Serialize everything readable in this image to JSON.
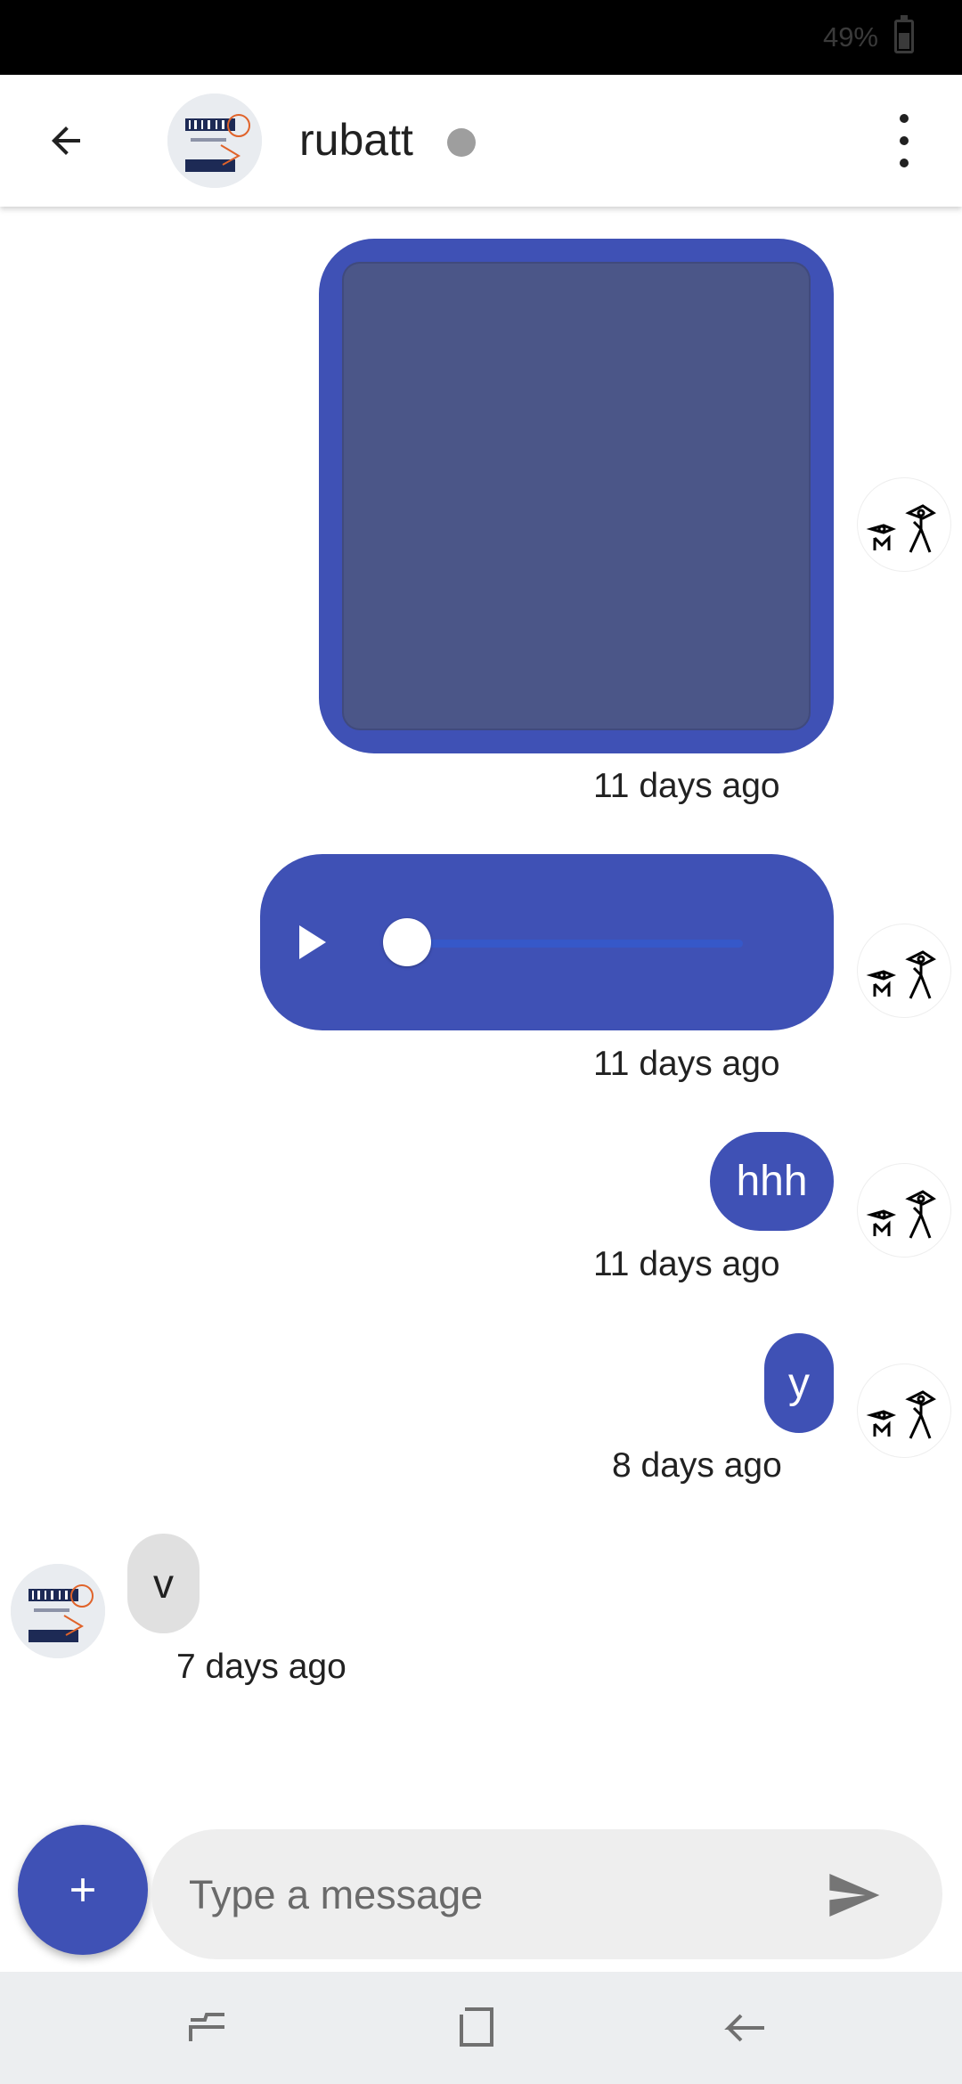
{
  "status_bar": {
    "battery": "49%"
  },
  "header": {
    "back_icon": "arrow-back-icon",
    "contact_name": "rubatt",
    "presence": "offline",
    "presence_color": "#9e9e9e",
    "menu_icon": "more-vert-icon"
  },
  "colors": {
    "accent": "#3f51b5",
    "incoming_bubble": "#e0e0e0",
    "image_placeholder": "#4b5688"
  },
  "messages": [
    {
      "type": "image",
      "direction": "outgoing",
      "timestamp": "11 days ago"
    },
    {
      "type": "audio",
      "direction": "outgoing",
      "progress": 0.0,
      "timestamp": "11 days ago"
    },
    {
      "type": "text",
      "direction": "outgoing",
      "text": "hhh",
      "timestamp": "11 days ago"
    },
    {
      "type": "text",
      "direction": "outgoing",
      "text": "y",
      "timestamp": "8 days ago"
    },
    {
      "type": "text",
      "direction": "incoming",
      "text": "v",
      "timestamp": "7 days ago"
    }
  ],
  "composer": {
    "placeholder": "Type a message",
    "attach_icon": "plus-icon",
    "send_icon": "send-icon"
  },
  "nav_bar": {
    "icons": [
      "recents-icon",
      "home-icon",
      "back-icon"
    ]
  }
}
